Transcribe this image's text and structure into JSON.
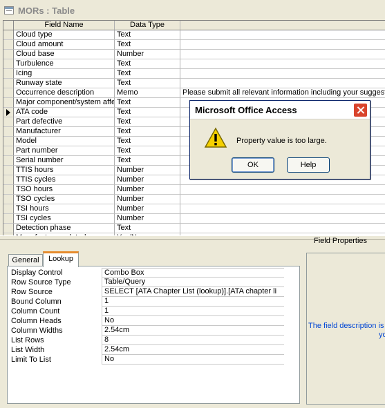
{
  "window": {
    "title": "MORs : Table"
  },
  "grid": {
    "headers": {
      "name": "Field Name",
      "type": "Data Type",
      "description": ""
    },
    "rows": [
      {
        "name": "Cloud type",
        "type": "Text",
        "description": ""
      },
      {
        "name": "Cloud amount",
        "type": "Text",
        "description": ""
      },
      {
        "name": "Cloud base",
        "type": "Number",
        "description": ""
      },
      {
        "name": "Turbulence",
        "type": "Text",
        "description": ""
      },
      {
        "name": "Icing",
        "type": "Text",
        "description": ""
      },
      {
        "name": "Runway state",
        "type": "Text",
        "description": ""
      },
      {
        "name": "Occurrence description",
        "type": "Memo",
        "description": "Please submit all relevant information including your suggestio"
      },
      {
        "name": "Major component/system affe",
        "type": "Text",
        "description": ""
      },
      {
        "name": "ATA code",
        "type": "Text",
        "description": ""
      },
      {
        "name": "Part defective",
        "type": "Text",
        "description": ""
      },
      {
        "name": "Manufacturer",
        "type": "Text",
        "description": ""
      },
      {
        "name": "Model",
        "type": "Text",
        "description": ""
      },
      {
        "name": "Part number",
        "type": "Text",
        "description": ""
      },
      {
        "name": "Serial number",
        "type": "Text",
        "description": ""
      },
      {
        "name": "TTIS hours",
        "type": "Number",
        "description": ""
      },
      {
        "name": "TTIS cycles",
        "type": "Number",
        "description": ""
      },
      {
        "name": "TSO hours",
        "type": "Number",
        "description": ""
      },
      {
        "name": "TSO cycles",
        "type": "Number",
        "description": ""
      },
      {
        "name": "TSI hours",
        "type": "Number",
        "description": ""
      },
      {
        "name": "TSI cycles",
        "type": "Number",
        "description": ""
      },
      {
        "name": "Detection phase",
        "type": "Text",
        "description": ""
      },
      {
        "name": "Manufacturer related",
        "type": "Yes/No",
        "description": ""
      }
    ],
    "current_row_index": 8
  },
  "field_properties": {
    "label": "Field Properties",
    "tabs": [
      {
        "label": "General",
        "active": false
      },
      {
        "label": "Lookup",
        "active": true
      }
    ],
    "properties": [
      {
        "label": "Display Control",
        "value": "Combo Box"
      },
      {
        "label": "Row Source Type",
        "value": "Table/Query"
      },
      {
        "label": "Row Source",
        "value": "SELECT [ATA Chapter List (lookup)].[ATA chapter li"
      },
      {
        "label": "Bound Column",
        "value": "1"
      },
      {
        "label": "Column Count",
        "value": "1"
      },
      {
        "label": "Column Heads",
        "value": "No"
      },
      {
        "label": "Column Widths",
        "value": "2.54cm"
      },
      {
        "label": "List Rows",
        "value": "8"
      },
      {
        "label": "List Width",
        "value": "2.54cm"
      },
      {
        "label": "Limit To List",
        "value": "No"
      }
    ],
    "help_text_line1": "The field description is o",
    "help_text_line2": "yo"
  },
  "dialog": {
    "title": "Microsoft Office Access",
    "icon": "warning-icon",
    "message": "Property value is too large.",
    "ok_label": "OK",
    "help_label": "Help"
  }
}
